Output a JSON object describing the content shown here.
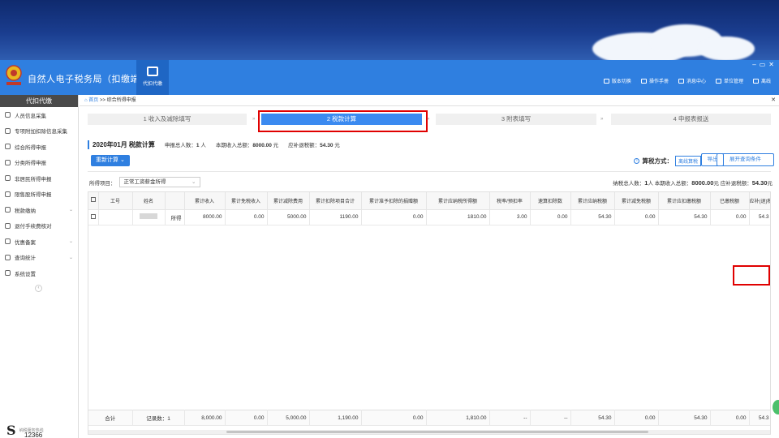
{
  "app": {
    "title": "自然人电子税务局（扣缴端）",
    "nav_tab": "代扣代缴",
    "tools": [
      "版本切换",
      "操作手册",
      "消息中心",
      "单位管理",
      "离线"
    ]
  },
  "sidebar": {
    "header": "代扣代缴",
    "items": [
      {
        "label": "人员信息采集",
        "arrow": ""
      },
      {
        "label": "专项附加扣除信息采集",
        "arrow": ""
      },
      {
        "label": "综合所得申报",
        "arrow": ""
      },
      {
        "label": "分类所得申报",
        "arrow": ""
      },
      {
        "label": "非居民所得申报",
        "arrow": ""
      },
      {
        "label": "限售股所得申报",
        "arrow": ""
      },
      {
        "label": "税款缴纳",
        "arrow": "⌄"
      },
      {
        "label": "退付手续费核对",
        "arrow": ""
      },
      {
        "label": "优惠备案",
        "arrow": "⌄"
      },
      {
        "label": "查询统计",
        "arrow": "⌄"
      },
      {
        "label": "系统设置",
        "arrow": ""
      }
    ],
    "hotline_label": "纳税服务热线",
    "hotline_number": "12366"
  },
  "breadcrumb": {
    "home": "首页",
    "sep": ">>",
    "current": "综合所得申报"
  },
  "steps": [
    {
      "label": "1 收入及减除填写",
      "active": false
    },
    {
      "label": "2 税款计算",
      "active": true
    },
    {
      "label": "3 附表填写",
      "active": false
    },
    {
      "label": "4 申报表报送",
      "active": false
    }
  ],
  "summary": {
    "period": "2020年01月  税款计算",
    "count_label": "申报总人数：",
    "count_value": "1",
    "count_unit": "人",
    "income_label": "本期收入总额：",
    "income_value": "8000.00",
    "income_unit": "元",
    "tax_label": "应补退税额：",
    "tax_value": "54.30",
    "tax_unit": "元"
  },
  "toolbar": {
    "recalc": "重新计算",
    "calc_mode_label": "算税方式：",
    "calc_mode_value": "离线算税",
    "export": "导出",
    "query": "展开查询条件"
  },
  "filter": {
    "label": "所得项目：",
    "value": "正常工资薪金所得"
  },
  "totals": {
    "text1": "纳税总人数：",
    "v1": "1",
    "u1": "人  本期收入总额：",
    "v2": "8000.00",
    "u2": "元  应补退税额：",
    "v3": "54.30",
    "u3": "元"
  },
  "table": {
    "headers": [
      "",
      "工号",
      "姓名",
      "",
      "累计收入",
      "累计免税收入",
      "累计减除费用",
      "累计扣除项目合计",
      "累计准予扣除的捐赠额",
      "累计应纳税所得额",
      "税率/预扣率",
      "速算扣除数",
      "累计应纳税额",
      "累计减免税额",
      "累计应扣缴税额",
      "已缴税额",
      "应补(退)税额"
    ],
    "row": [
      "",
      "",
      "",
      "所得",
      "8000.00",
      "0.00",
      "5000.00",
      "1190.00",
      "0.00",
      "1810.00",
      "3.00",
      "0.00",
      "54.30",
      "0.00",
      "54.30",
      "0.00",
      "54.3"
    ],
    "footer": [
      "合计",
      "记录数：1",
      "",
      "8,000.00",
      "0.00",
      "5,000.00",
      "1,190.00",
      "0.00",
      "1,810.00",
      "--",
      "--",
      "54.30",
      "0.00",
      "54.30",
      "0.00",
      "54.3"
    ]
  }
}
